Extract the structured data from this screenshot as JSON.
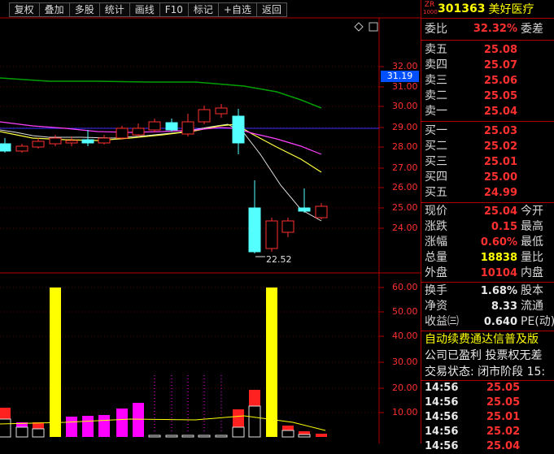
{
  "toolbar": [
    "复权",
    "叠加",
    "多股",
    "统计",
    "画线",
    "F10",
    "标记",
    "+自选",
    "返回"
  ],
  "chart": {
    "last_price_tag": "31.19",
    "low_label": "22.52",
    "price_axis": [
      "32.00",
      "31.00",
      "30.00",
      "29.00",
      "28.00",
      "27.00",
      "26.00",
      "25.00",
      "24.00"
    ],
    "volume_axis": [
      "60.00",
      "50.00",
      "40.00",
      "30.00",
      "20.00",
      "10.00"
    ]
  },
  "quote": {
    "badge_top": "ZR",
    "badge_bottom": "1000",
    "code": "301363",
    "name": "美好医疗",
    "weibi_label": "委比",
    "weibi_value": "32.32%",
    "weicha_label": "委差",
    "sell": [
      {
        "label": "卖五",
        "price": "25.08"
      },
      {
        "label": "卖四",
        "price": "25.07"
      },
      {
        "label": "卖三",
        "price": "25.06"
      },
      {
        "label": "卖二",
        "price": "25.05"
      },
      {
        "label": "卖一",
        "price": "25.04"
      }
    ],
    "buy": [
      {
        "label": "买一",
        "price": "25.03"
      },
      {
        "label": "买二",
        "price": "25.02"
      },
      {
        "label": "买三",
        "price": "25.01"
      },
      {
        "label": "买四",
        "price": "25.00"
      },
      {
        "label": "买五",
        "price": "24.99"
      }
    ],
    "stats": [
      {
        "label": "现价",
        "value": "25.04",
        "label2": "今开",
        "color": "red"
      },
      {
        "label": "涨跌",
        "value": "0.15",
        "label2": "最高",
        "color": "red"
      },
      {
        "label": "涨幅",
        "value": "0.60%",
        "label2": "最低",
        "color": "red"
      },
      {
        "label": "总量",
        "value": "18838",
        "label2": "量比",
        "color": "yellow"
      },
      {
        "label": "外盘",
        "value": "10104",
        "label2": "内盘",
        "color": "red"
      }
    ],
    "stats2": [
      {
        "label": "换手",
        "value": "1.68%",
        "label2": "股本"
      },
      {
        "label": "净资",
        "value": "8.33",
        "label2": "流通"
      },
      {
        "label": "收益㈢",
        "value": "0.640",
        "label2": "PE(动)"
      }
    ],
    "info_lines": [
      {
        "text": "自动续费通达信普及版",
        "color": "yellow"
      },
      {
        "text": "公司已盈利 投票权无差",
        "color": "white"
      },
      {
        "text": "交易状态: 闭市阶段 15:",
        "color": "white"
      }
    ],
    "ticks": [
      {
        "time": "14:56",
        "price": "25.05"
      },
      {
        "time": "14:56",
        "price": "25.05"
      },
      {
        "time": "14:56",
        "price": "25.01"
      },
      {
        "time": "14:56",
        "price": "25.02"
      },
      {
        "time": "14:56",
        "price": "25.04"
      }
    ]
  },
  "colors": {
    "up": "#ff3030",
    "down": "#54ffff",
    "accent_blue": "#0050ff",
    "yellow": "#ffff00",
    "magenta": "#ff00ff"
  }
}
